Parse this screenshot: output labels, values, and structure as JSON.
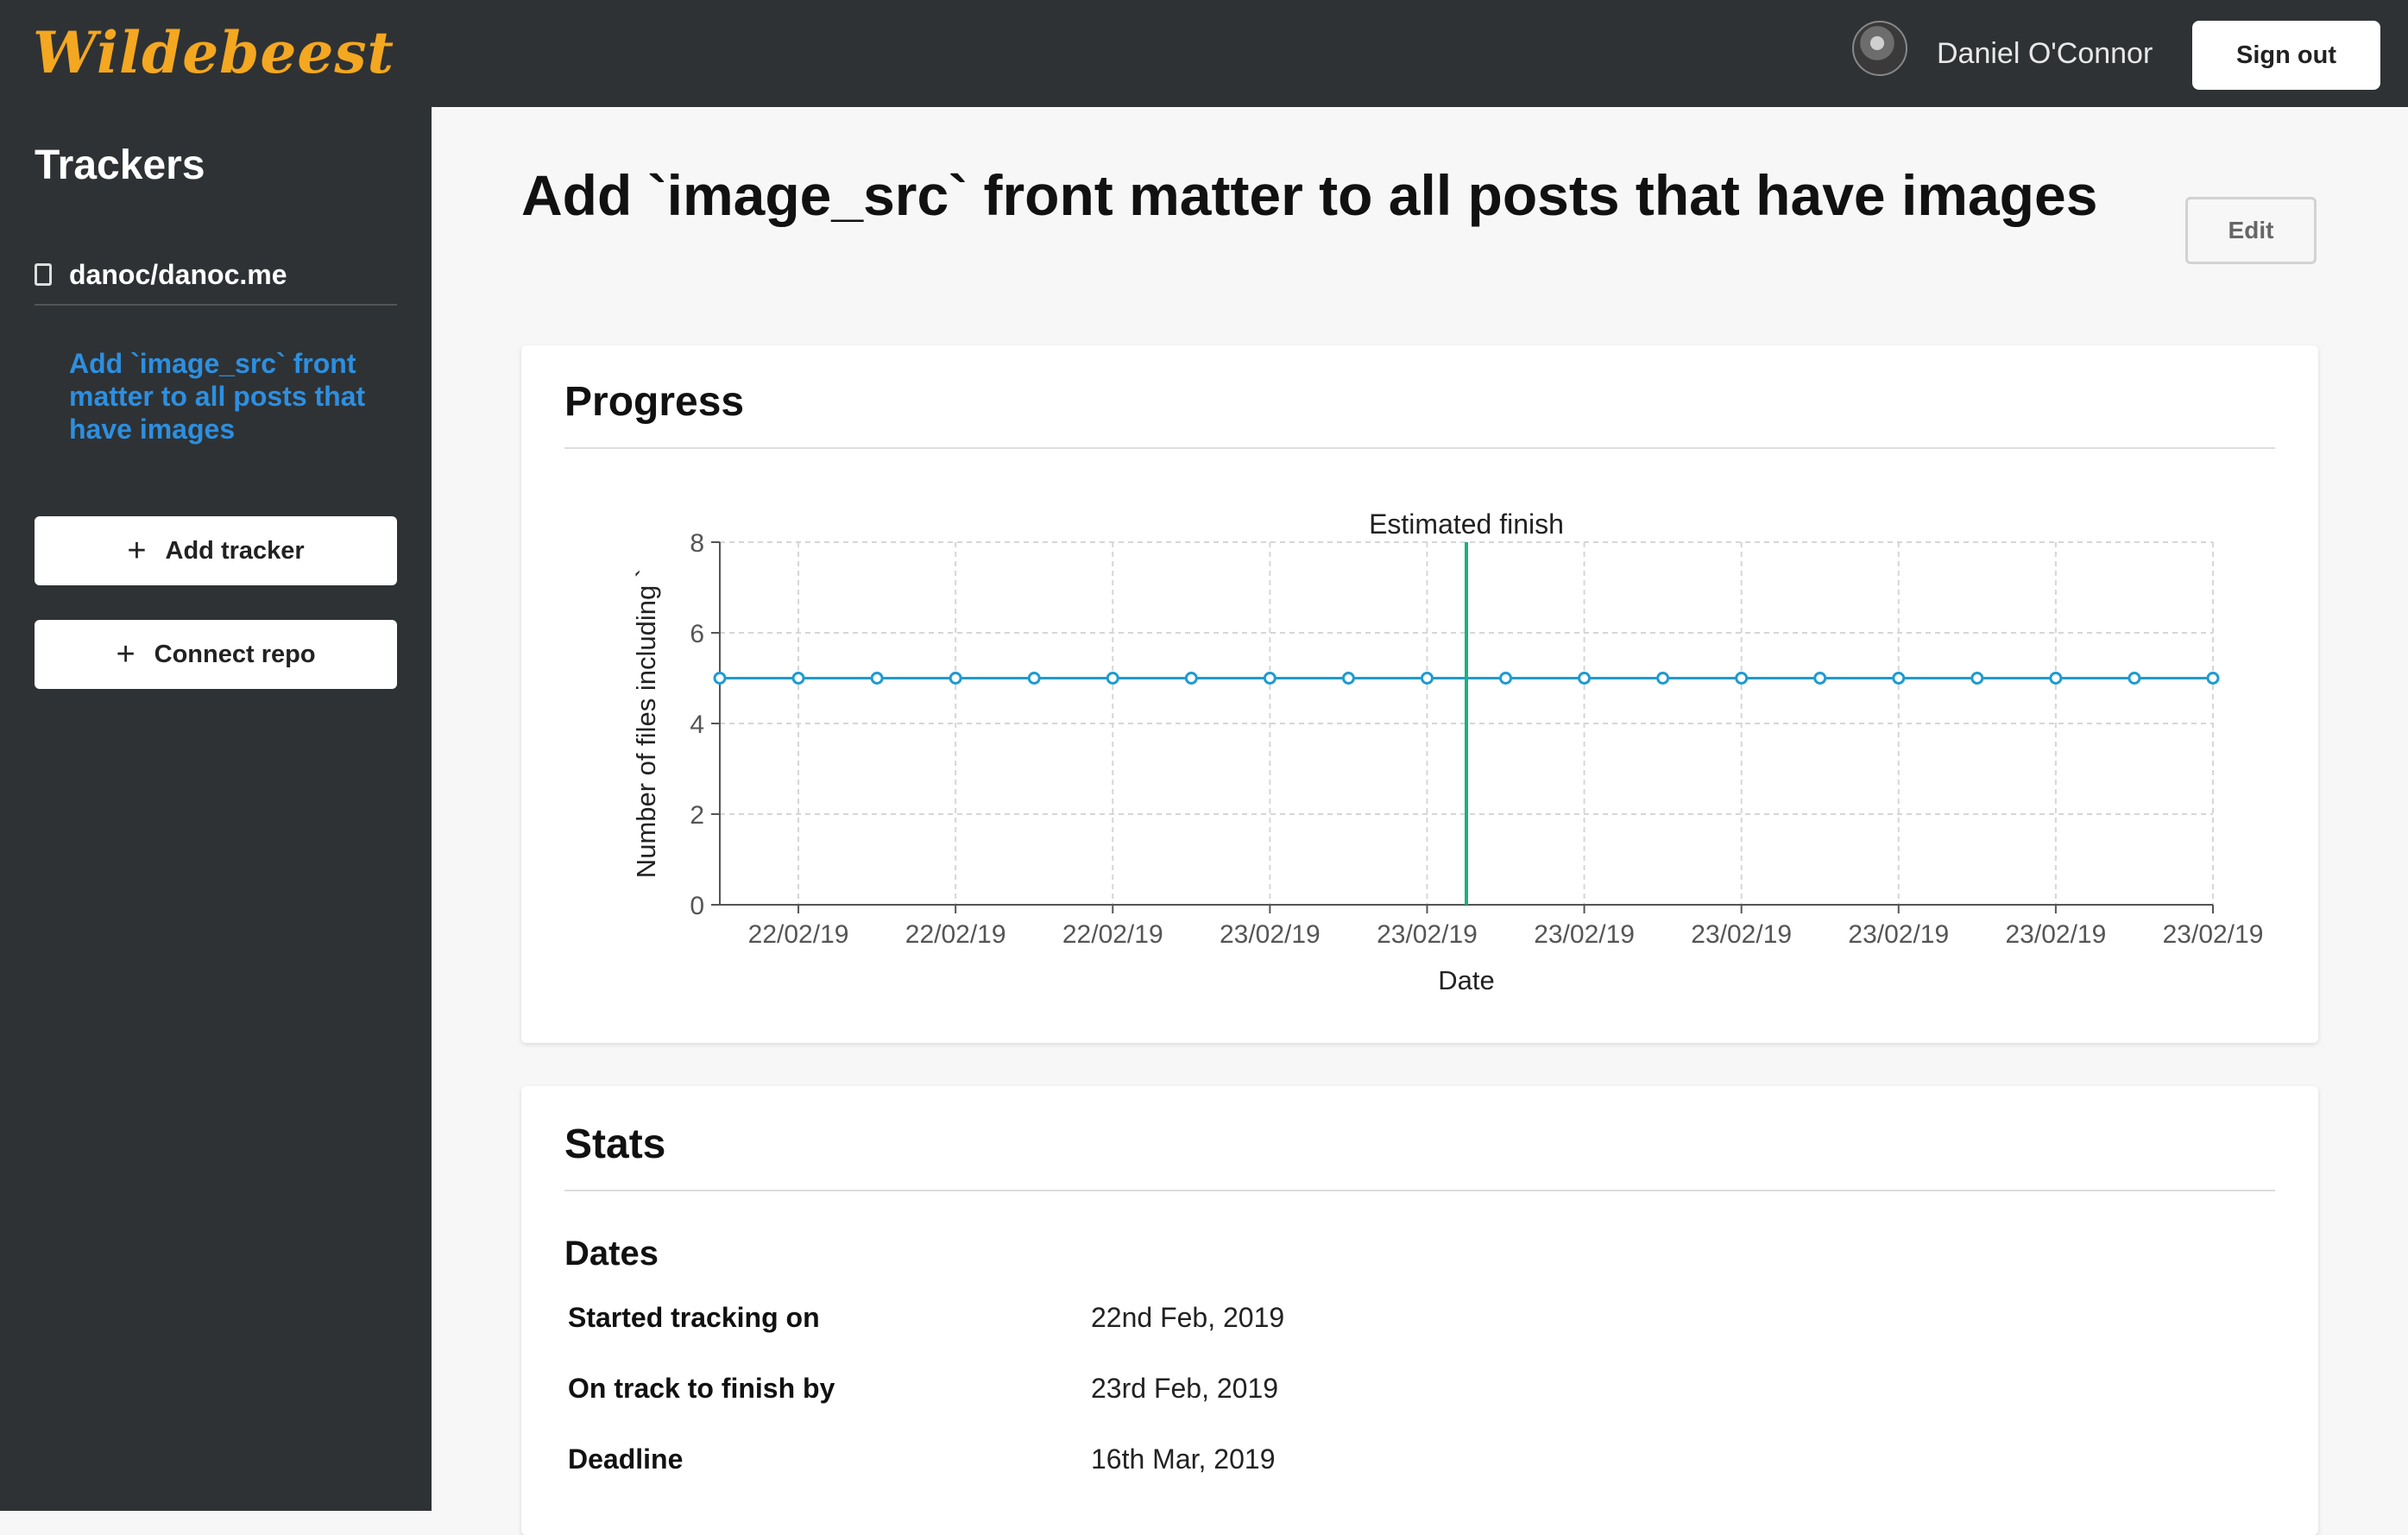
{
  "app": {
    "logo_text": "Wildebeest"
  },
  "header": {
    "user_name": "Daniel O'Connor",
    "sign_out_label": "Sign out"
  },
  "sidebar": {
    "title": "Trackers",
    "repo": "danoc/danoc.me",
    "tracker_link": "Add `image_src` front matter to all posts that have images",
    "add_tracker_label": "Add tracker",
    "connect_repo_label": "Connect repo"
  },
  "main": {
    "title": "Add `image_src` front matter to all posts that have images",
    "edit_label": "Edit"
  },
  "progress": {
    "heading": "Progress"
  },
  "chart_data": {
    "type": "line",
    "xlabel": "Date",
    "ylabel": "Number of files including `",
    "ylim": [
      0,
      8
    ],
    "yticks": [
      0,
      2,
      4,
      6,
      8
    ],
    "x_tick_labels": [
      "22/02/19",
      "22/02/19",
      "22/02/19",
      "23/02/19",
      "23/02/19",
      "23/02/19",
      "23/02/19",
      "23/02/19",
      "23/02/19",
      "23/02/19"
    ],
    "values": [
      5,
      5,
      5,
      5,
      5,
      5,
      5,
      5,
      5,
      5,
      5,
      5,
      5,
      5,
      5,
      5,
      5,
      5,
      5,
      5
    ],
    "marker_index": 9.5,
    "annotation": "Estimated finish",
    "grid": true,
    "series_color": "#1f9bd1",
    "marker_color": "#1fb07a"
  },
  "stats": {
    "heading": "Stats",
    "dates_heading": "Dates",
    "rows": [
      {
        "label": "Started tracking on",
        "value": "22nd Feb, 2019"
      },
      {
        "label": "On track to finish by",
        "value": "23rd Feb, 2019"
      },
      {
        "label": "Deadline",
        "value": "16th Mar, 2019"
      }
    ]
  }
}
